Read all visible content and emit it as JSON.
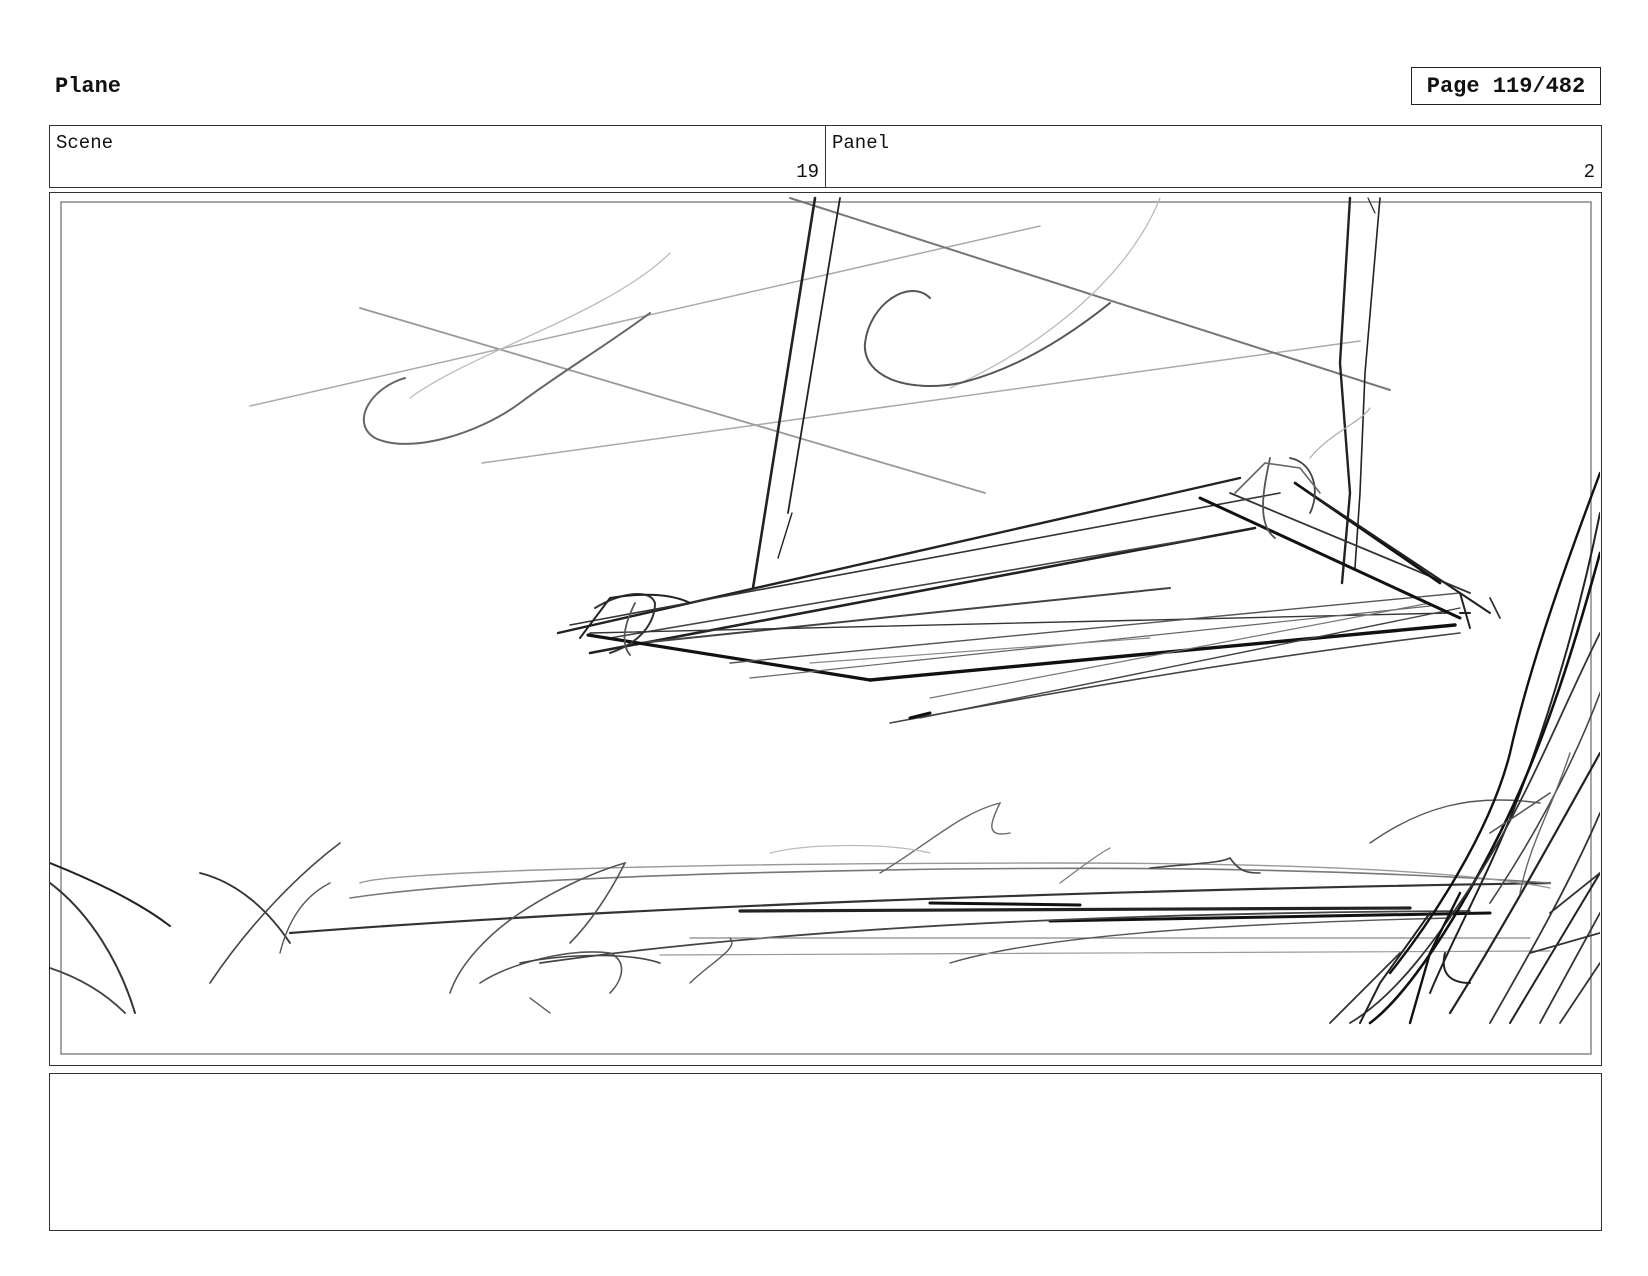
{
  "header": {
    "title": "Plane",
    "page_label": "Page 119/482"
  },
  "info": {
    "scene_label": "Scene",
    "scene_value": "19",
    "panel_label": "Panel",
    "panel_value": "2"
  },
  "panel": {
    "illustration": "rough-sketch"
  },
  "notes": {
    "text": ""
  }
}
